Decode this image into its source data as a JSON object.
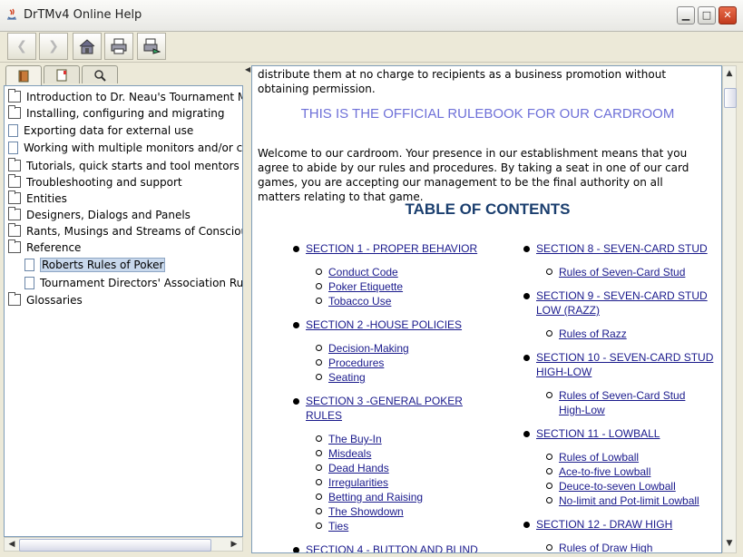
{
  "window": {
    "title": "DrTMv4 Online Help"
  },
  "toolbar": {
    "buttons": [
      {
        "name": "back-button",
        "icon": "arrow-left-icon"
      },
      {
        "name": "forward-button",
        "icon": "arrow-right-icon"
      },
      {
        "name": "home-button",
        "icon": "home-icon"
      },
      {
        "name": "print-button",
        "icon": "printer-icon"
      },
      {
        "name": "page-setup-button",
        "icon": "page-setup-icon"
      }
    ]
  },
  "nav_tabs": [
    "contents-icon",
    "index-icon",
    "search-icon"
  ],
  "tree": {
    "items": [
      {
        "label": "Introduction to Dr. Neau's Tournament Manager",
        "type": "folder"
      },
      {
        "label": "Installing, configuring and migrating",
        "type": "folder"
      },
      {
        "label": "Exporting data for external use",
        "type": "doc"
      },
      {
        "label": "Working with multiple monitors and/or computers",
        "type": "doc"
      },
      {
        "label": "Tutorials, quick starts and tool mentors",
        "type": "folder"
      },
      {
        "label": "Troubleshooting and support",
        "type": "folder"
      },
      {
        "label": "Entities",
        "type": "folder"
      },
      {
        "label": "Designers, Dialogs and Panels",
        "type": "folder"
      },
      {
        "label": "Rants, Musings and Streams of Consciousness",
        "type": "folder"
      },
      {
        "label": "Reference",
        "type": "folder"
      },
      {
        "label": "Roberts Rules of Poker",
        "type": "doc",
        "child": true,
        "selected": true
      },
      {
        "label": "Tournament Directors' Association Rules",
        "type": "doc",
        "child": true
      },
      {
        "label": "Glossaries",
        "type": "folder"
      }
    ]
  },
  "content": {
    "intro_text": "distribute them at no charge to recipients as a business promotion without obtaining permission.",
    "official_heading": "THIS IS THE OFFICIAL RULEBOOK FOR OUR CARDROOM",
    "welcome_text": "Welcome to our cardroom. Your presence in our establishment means that you agree to abide by our rules and procedures. By taking a seat in one of our card games, you are accepting our management to be the final authority on all matters relating to that game.",
    "toc_heading": "TABLE OF CONTENTS",
    "left_sections": [
      {
        "title": "SECTION 1 - PROPER BEHAVIOR",
        "subs": [
          "Conduct Code",
          "Poker Etiquette",
          "Tobacco Use"
        ]
      },
      {
        "title": "SECTION 2 -HOUSE POLICIES",
        "subs": [
          "Decision-Making",
          "Procedures",
          "Seating"
        ]
      },
      {
        "title": "SECTION 3 -GENERAL POKER RULES",
        "subs": [
          "The Buy-In",
          "Misdeals",
          "Dead Hands",
          "Irregularities",
          "Betting and Raising",
          "The Showdown",
          "Ties"
        ]
      },
      {
        "title": "SECTION 4 - BUTTON AND BLIND",
        "subs": []
      }
    ],
    "right_sections": [
      {
        "title": "SECTION 8 - SEVEN-CARD STUD",
        "subs": [
          "Rules of Seven-Card Stud"
        ]
      },
      {
        "title": "SECTION 9 - SEVEN-CARD STUD LOW (RAZZ)",
        "subs": [
          "Rules of Razz"
        ]
      },
      {
        "title": "SECTION 10 - SEVEN-CARD STUD HIGH-LOW",
        "subs": [
          "Rules of Seven-Card Stud High-Low"
        ]
      },
      {
        "title": "SECTION 11 - LOWBALL",
        "subs": [
          "Rules of Lowball",
          "Ace-to-five Lowball",
          "Deuce-to-seven Lowball",
          "No-limit and Pot-limit Lowball"
        ]
      },
      {
        "title": "SECTION 12 - DRAW HIGH",
        "subs": [
          "Rules of Draw High"
        ]
      }
    ]
  }
}
